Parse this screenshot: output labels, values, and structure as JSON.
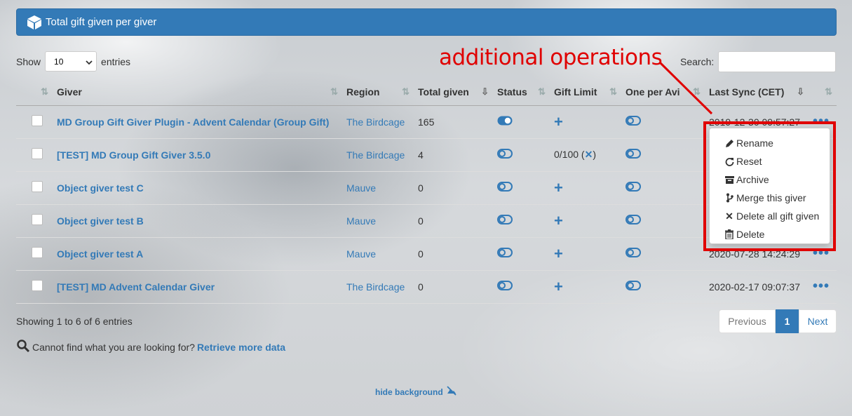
{
  "header": {
    "title": "Total gift given per giver"
  },
  "length": {
    "show_label": "Show",
    "selected": "10",
    "entries_label": "entries"
  },
  "search": {
    "label": "Search:",
    "value": ""
  },
  "annotation": {
    "text": "additional operations",
    "color": "#e00000"
  },
  "table": {
    "columns": [
      "Giver",
      "Region",
      "Total given",
      "Status",
      "Gift Limit",
      "One per Avi",
      "Last Sync (CET)"
    ],
    "rows": [
      {
        "giver": "MD Group Gift Giver Plugin - Advent Calendar (Group Gift)",
        "region": "The Birdcage",
        "total": "165",
        "status": "on",
        "limit": "+",
        "last_sync": "2019-12-30 09:57:27"
      },
      {
        "giver": "[TEST] MD Group Gift Giver 3.5.0",
        "region": "The Birdcage",
        "total": "4",
        "status": "off",
        "limit": "0/100",
        "last_sync": ""
      },
      {
        "giver": "Object giver test C",
        "region": "Mauve",
        "total": "0",
        "status": "off",
        "limit": "+",
        "last_sync": ""
      },
      {
        "giver": "Object giver test B",
        "region": "Mauve",
        "total": "0",
        "status": "off",
        "limit": "+",
        "last_sync": ""
      },
      {
        "giver": "Object giver test A",
        "region": "Mauve",
        "total": "0",
        "status": "off",
        "limit": "+",
        "last_sync": "2020-07-28 14:24:29"
      },
      {
        "giver": "[TEST] MD Advent Calendar Giver",
        "region": "The Birdcage",
        "total": "0",
        "status": "off",
        "limit": "+",
        "last_sync": "2020-02-17 09:07:37"
      }
    ]
  },
  "actions_menu": {
    "items": [
      {
        "label": "Rename",
        "icon": "pencil-icon"
      },
      {
        "label": "Reset",
        "icon": "refresh-icon"
      },
      {
        "label": "Archive",
        "icon": "archive-icon"
      },
      {
        "label": "Merge this giver",
        "icon": "merge-icon"
      },
      {
        "label": "Delete all gift given",
        "icon": "x-icon"
      },
      {
        "label": "Delete",
        "icon": "trash-icon"
      }
    ]
  },
  "footer": {
    "info": "Showing 1 to 6 of 6 entries",
    "cannot_find": "Cannot find what you are looking for?",
    "retrieve_link": "Retrieve more data",
    "hide_bg": "hide background"
  },
  "pagination": {
    "previous": "Previous",
    "current": "1",
    "next": "Next"
  },
  "colors": {
    "accent": "#337ab7",
    "annotation": "#e00000"
  }
}
